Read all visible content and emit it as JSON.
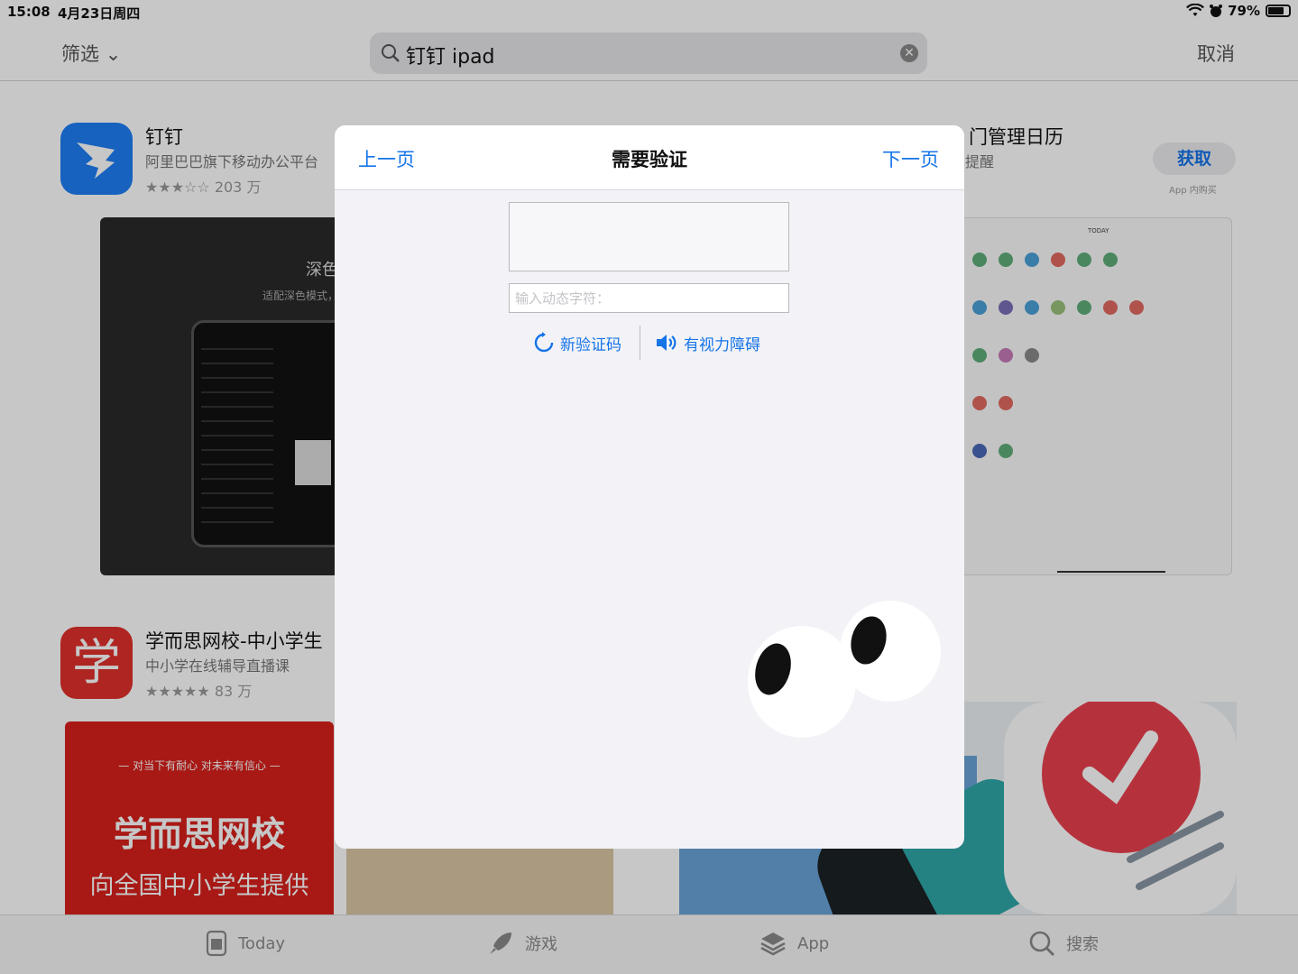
{
  "status": {
    "time": "15:08",
    "date": "4月23日周四",
    "battery": "79%",
    "battery_level": 0.79
  },
  "search": {
    "filter_label": "筛选",
    "query": "钉钉 ipad",
    "cancel_label": "取消"
  },
  "listings": [
    {
      "title": "钉钉",
      "subtitle": "阿里巴巴旗下移动办公平台",
      "stars": "★★★☆☆",
      "rating_count": "203 万",
      "icon_color": "#1e7ef5",
      "screenshot_title": "深色",
      "screenshot_sub": "适配深色模式，"
    },
    {
      "title": "学而思网校-中小学生",
      "subtitle": "中小学在线辅导直播课",
      "stars": "★★★★★",
      "rating_count": "83 万",
      "icon_color": "#e0302b",
      "icon_glyph": "学",
      "banner_tagline": "— 对当下有耐心  对未来有信心 —",
      "banner_title": "学而思网校",
      "banner_sub": "向全国中小学生提供"
    }
  ],
  "right_listing": {
    "title_fragment": "门管理日历",
    "sub_fragment": "提醒",
    "get_label": "获取",
    "iap_label": "App 内购买",
    "today_label": "TODAY"
  },
  "modal": {
    "prev_label": "上一页",
    "title": "需要验证",
    "next_label": "下一页",
    "input_placeholder": "输入动态字符：",
    "refresh_label": "新验证码",
    "audio_label": "有视力障碍"
  },
  "tabs": [
    {
      "label": "Today",
      "icon": "today-icon"
    },
    {
      "label": "游戏",
      "icon": "rocket-icon"
    },
    {
      "label": "App",
      "icon": "layers-icon"
    },
    {
      "label": "搜索",
      "icon": "search-icon"
    }
  ],
  "colors": {
    "accent": "#1574e8",
    "dingtalk_blue": "#1e7ef5",
    "xueersi_red": "#e0302b"
  }
}
